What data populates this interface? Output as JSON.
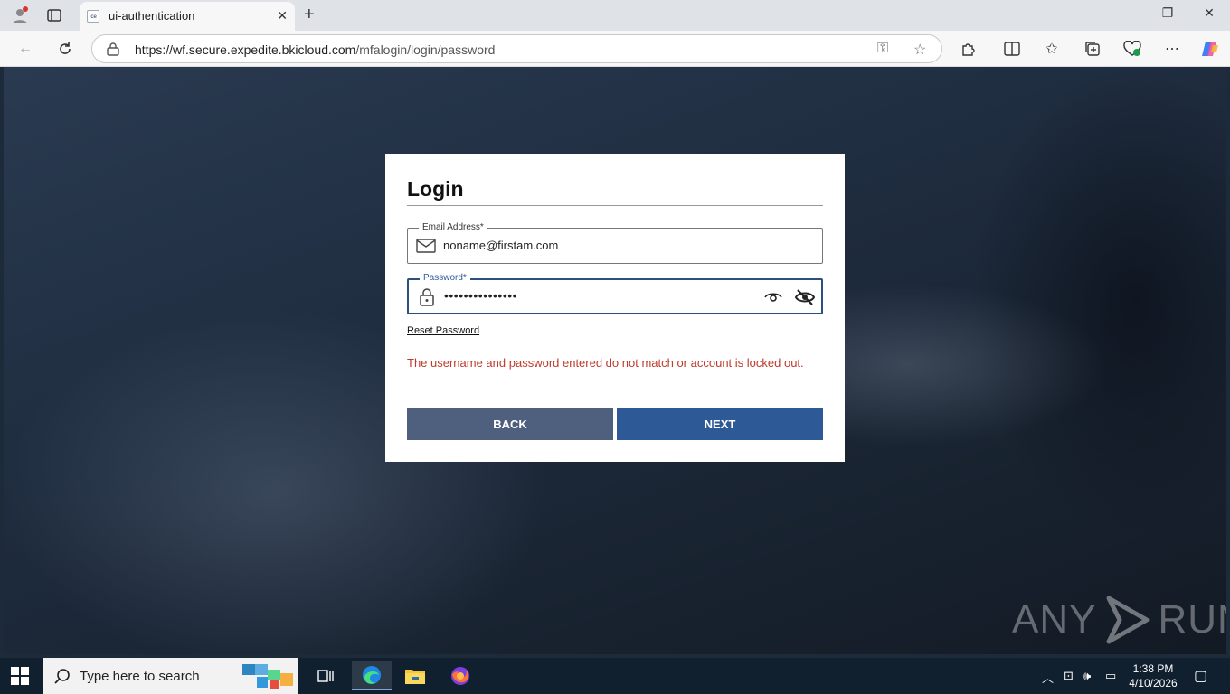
{
  "browser": {
    "tab_title": "ui-authentication",
    "tab_favicon_text": "ice",
    "url_host": "https://wf.secure.expedite.bkicloud.com",
    "url_path": "/mfalogin/login/password"
  },
  "login": {
    "title": "Login",
    "email_label": "Email Address*",
    "email_value": "noname@firstam.com",
    "password_label": "Password*",
    "password_value": "•••••••••••••••",
    "reset_link": "Reset Password",
    "error": "The username and password entered do not match or account is locked out.",
    "back_label": "BACK",
    "next_label": "NEXT"
  },
  "watermark": {
    "left": "ANY",
    "right": "RUN"
  },
  "taskbar": {
    "search_placeholder": "Type here to search",
    "time": "1:38 PM",
    "date": "4/10/2026"
  },
  "colors": {
    "primary": "#2d5a96",
    "secondary": "#4f5f7e",
    "error": "#c0392b"
  }
}
